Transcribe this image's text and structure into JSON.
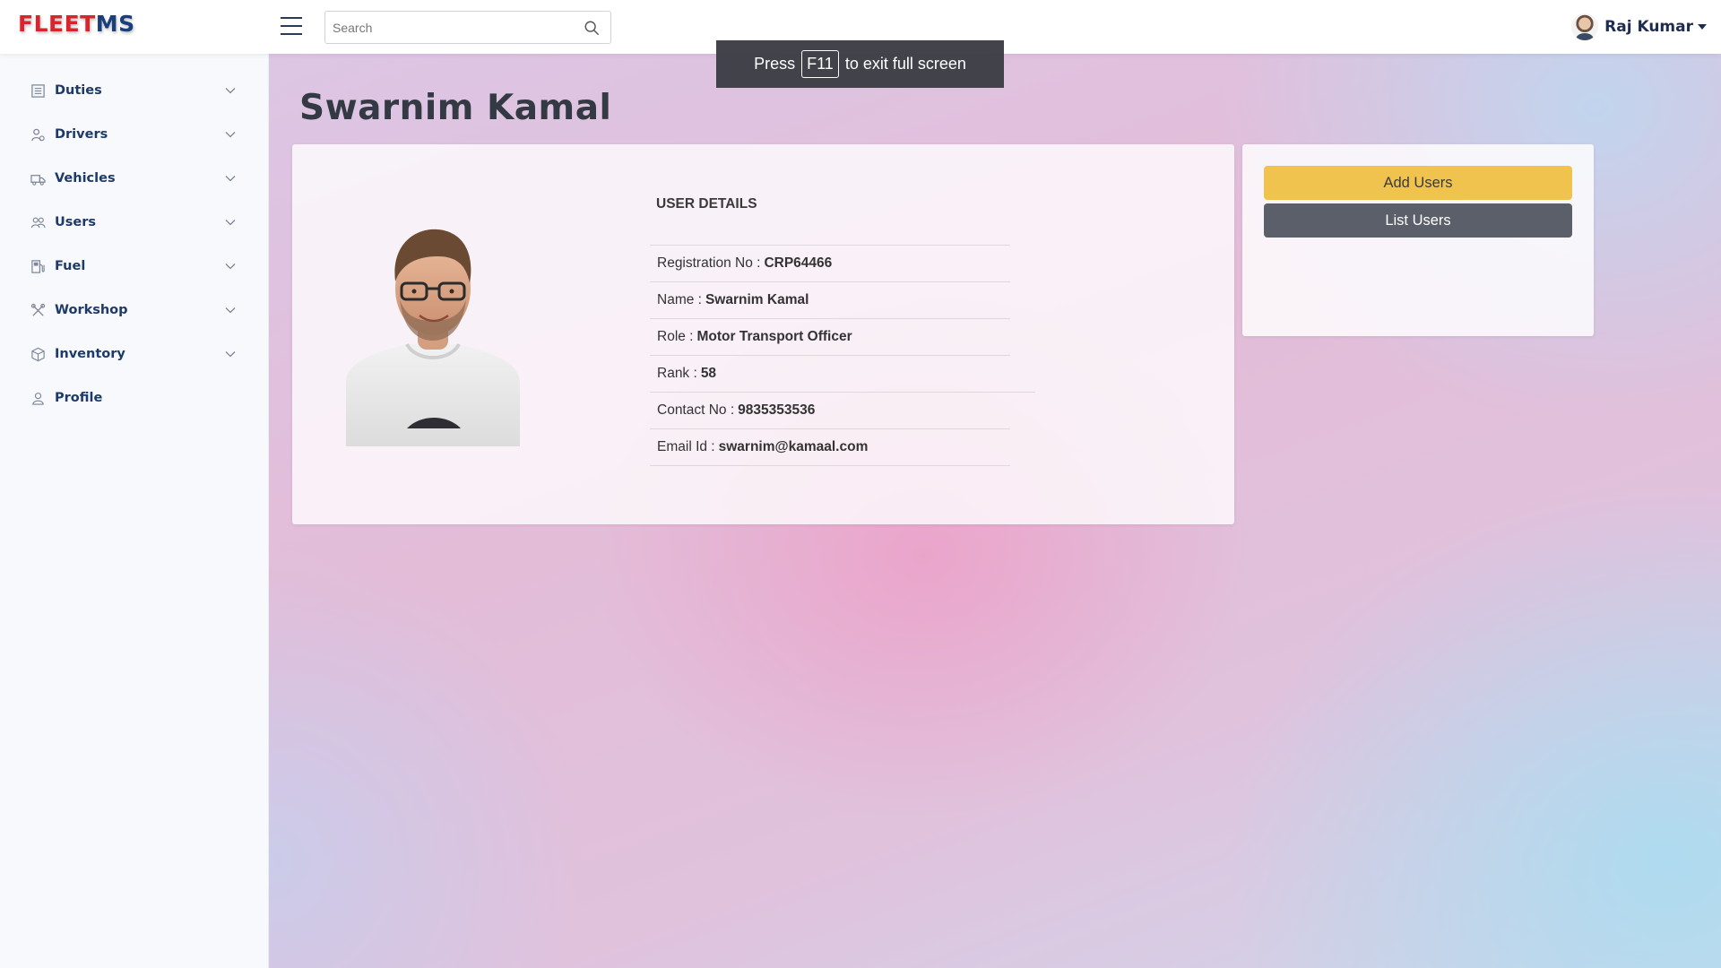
{
  "header": {
    "logo_part1": "FLEET",
    "logo_part2": "MS",
    "search_placeholder": "Search",
    "user_name": "Raj Kumar"
  },
  "sidebar": {
    "items": [
      {
        "label": "Duties",
        "icon": "list-icon",
        "expandable": true
      },
      {
        "label": "Drivers",
        "icon": "driver-icon",
        "expandable": true
      },
      {
        "label": "Vehicles",
        "icon": "truck-icon",
        "expandable": true
      },
      {
        "label": "Users",
        "icon": "users-icon",
        "expandable": true
      },
      {
        "label": "Fuel",
        "icon": "fuel-icon",
        "expandable": true
      },
      {
        "label": "Workshop",
        "icon": "tools-icon",
        "expandable": true
      },
      {
        "label": "Inventory",
        "icon": "box-icon",
        "expandable": true
      },
      {
        "label": "Profile",
        "icon": "person-icon",
        "expandable": false
      }
    ]
  },
  "main": {
    "page_title": "Swarnim Kamal",
    "details_heading": "USER DETAILS",
    "details": [
      {
        "label": "Registration No :",
        "value": "CRP64466"
      },
      {
        "label": "Name :",
        "value": "Swarnim Kamal"
      },
      {
        "label": "Role :",
        "value": "Motor Transport Officer"
      },
      {
        "label": "Rank :",
        "value": "58"
      },
      {
        "label": "Contact No :",
        "value": "9835353536"
      },
      {
        "label": "Email Id :",
        "value": "swarnim@kamaal.com"
      }
    ],
    "actions": {
      "add_label": "Add Users",
      "list_label": "List Users"
    }
  },
  "fullscreen_toast": {
    "before": "Press",
    "key": "F11",
    "after": "to exit full screen"
  },
  "colors": {
    "logo_red": "#d9232d",
    "logo_blue": "#1b3f7a",
    "nav_text": "#1e3a68",
    "add_button": "#f0c34f",
    "list_button": "#5b5f6a"
  }
}
